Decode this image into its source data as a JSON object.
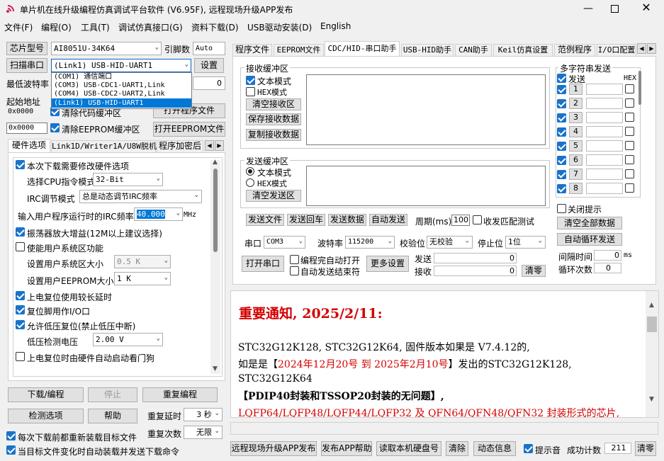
{
  "window": {
    "title": "单片机在线升级编程仿真调试平台软件 (V6.95F), 远程现场升级APP发布"
  },
  "menu": [
    "文件(F)",
    "编程(O)",
    "工具(T)",
    "调试仿真接口(G)",
    "资料下载(D)",
    "USB驱动安装(D)",
    "English"
  ],
  "left": {
    "chip_label": "芯片型号",
    "chip_value": "AI8051U-34K64",
    "pins_label": "引脚数",
    "pins_value": "Auto",
    "scan_button": "扫描串口",
    "port_value": "(Link1) USB-HID-UART1",
    "settings_button": "设置",
    "port_options": [
      "(COM1) 通信端口",
      "(COM3) USB-CDC1-UART1,Link",
      "(COM4) USB-CDC2-UART2,Link",
      "(Link1) USB-HID-UART1"
    ],
    "min_baud_label": "最低波特率",
    "min_baud_suffix": "0",
    "start_addr_label": "起始地址",
    "addr1": "0x0000",
    "addr2": "0x0000",
    "clear_code_label": "清除代码缓冲区",
    "clear_eeprom_label": "清除EEPROM缓冲区",
    "open_prog_button": "打开程序文件",
    "open_eeprom_button": "打开EEPROM文件",
    "tabs": [
      "硬件选项",
      "Link1D/Writer1A/U8W脱机",
      "程序加密后"
    ],
    "opt_rehw": "本次下载需要修改硬件选项",
    "cpu_mode_label": "选择CPU指令模式",
    "cpu_mode_value": "32-Bit",
    "irc_mode_label": "IRC调节模式",
    "irc_mode_value": "总是动态调节IRC频率",
    "irc_freq_label": "输入用户程序运行时的IRC频率",
    "irc_freq_value": "40.000",
    "irc_freq_unit": "MHz",
    "osc_gain": "振荡器放大增益(12M以上建议选择)",
    "sys_area": "使能用户系统区功能",
    "sys_size_label": "设置用户系统区大小",
    "sys_size_value": "0.5 K",
    "eeprom_size_label": "设置用户EEPROM大小",
    "eeprom_size_value": "1   K",
    "por_delay": "上电复位使用较长延时",
    "reset_pin": "复位脚用作I/O口",
    "lvr": "允许低压复位(禁止低压中断)",
    "lvd_label": "低压检测电压",
    "lvd_value": "2.00 V",
    "wdt": "上电复位时由硬件自动启动看门狗",
    "download_button": "下载/编程",
    "stop_button": "停止",
    "reprogram_button": "重复编程",
    "check_button": "检测选项",
    "help_button": "帮助",
    "repeat_delay_label": "重复延时",
    "repeat_delay_value": "3 秒",
    "repeat_count_label": "重复次数",
    "repeat_count_value": "无限",
    "reload_each": "每次下载前都重新装载目标文件",
    "auto_load": "当目标文件变化时自动装载并发送下载命令"
  },
  "right": {
    "tabs": [
      "程序文件",
      "EEPROM文件",
      "CDC/HID-串口助手",
      "USB-HID助手",
      "CAN助手",
      "Keil仿真设置",
      "范例程序",
      "I/O口配置"
    ],
    "recv_title": "接收缓冲区",
    "text_mode": "文本模式",
    "hex_mode": "HEX模式",
    "clear_recv": "清空接收区",
    "save_recv": "保存接收数据",
    "copy_recv": "复制接收数据",
    "send_title": "发送缓冲区",
    "clear_send": "清空发送区",
    "send_file": "发送文件",
    "send_return": "发送回车",
    "send_data": "发送数据",
    "auto_send": "自动发送",
    "period_label": "周期(ms)",
    "period_value": "100",
    "match_label": "收发匹配测试",
    "port_label": "串口",
    "port_value": "COM3",
    "baud_label": "波特率",
    "baud_value": "115200",
    "parity_label": "校验位",
    "parity_value": "无校验",
    "stop_label": "停止位",
    "stop_value": "1位",
    "open_port": "打开串口",
    "auto_open": "编程完自动打开",
    "auto_close": "自动发送结束符",
    "more": "更多设置",
    "tx_label": "发送",
    "tx_value": "0",
    "rx_label": "接收",
    "rx_value": "0",
    "clear_count": "清零",
    "multi_title": "多字符串发送",
    "multi_send": "发送",
    "multi_hex": "HEX",
    "multi_rows": [
      "1",
      "2",
      "3",
      "4",
      "5",
      "6",
      "7",
      "8"
    ],
    "close_tip": "关闭提示",
    "clear_all": "清空全部数据",
    "auto_loop": "自动循环发送",
    "interval_label": "间隔时间",
    "interval_value": "0",
    "interval_unit": "ms",
    "loop_count_label": "循环次数",
    "loop_count_value": "0"
  },
  "notice": {
    "title": "重要通知, 2025/2/11:",
    "line1": "STC32G12K128, STC32G12K64, 固件版本如果是 V7.4.12的,",
    "line2a": "如是是【",
    "line2b": "2024年12月20号 到 2025年2月10号",
    "line2c": "】发出的STC32G12K128,",
    "line3": "STC32G12K64",
    "line4": "【PDIP40封装和TSSOP20封装的无问题】,",
    "line5": "LQFP64/LQFP48/LQFP44/LQFP32 及 QFN64/QFN48/QFN32 封装形式的芯片,"
  },
  "bottom": {
    "remote": "远程现场升级APP发布",
    "publish_help": "发布APP帮助",
    "read_disk": "读取本机硬盘号",
    "clear": "清除",
    "dynamic_info": "动态信息",
    "beep": "提示音",
    "success_label": "成功计数",
    "success_value": "211",
    "clear_count": "清零"
  }
}
